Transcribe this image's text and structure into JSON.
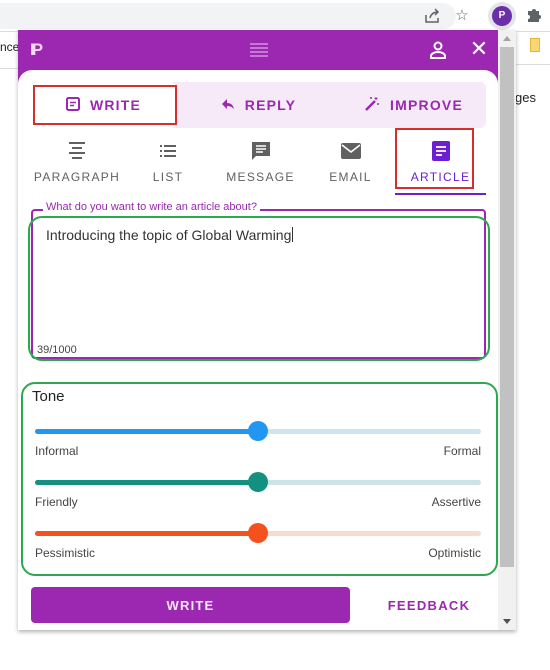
{
  "browser": {
    "icons": [
      "share-icon",
      "bookmark-star-icon",
      "extension-logo-icon",
      "extensions-puzzle-icon"
    ],
    "extension_logo_text": "P",
    "background_text_left": "nce",
    "background_text_right": "ges"
  },
  "popup": {
    "header": {
      "logo_text": "IP",
      "icons": [
        "drag-handle-icon",
        "user-icon",
        "close-icon"
      ],
      "close_glyph": "✕"
    },
    "mode_tabs": [
      {
        "label": "WRITE",
        "icon": "note-icon",
        "active": true,
        "highlighted": true
      },
      {
        "label": "REPLY",
        "icon": "reply-icon",
        "active": false
      },
      {
        "label": "IMPROVE",
        "icon": "magic-wand-icon",
        "active": false
      }
    ],
    "type_tabs": [
      {
        "label": "PARAGRAPH",
        "icon": "align-center-icon",
        "active": false
      },
      {
        "label": "LIST",
        "icon": "list-icon",
        "active": false
      },
      {
        "label": "MESSAGE",
        "icon": "chat-bubble-icon",
        "active": false
      },
      {
        "label": "EMAIL",
        "icon": "mail-icon",
        "active": false
      },
      {
        "label": "ARTICLE",
        "icon": "article-icon",
        "active": true,
        "highlighted": true
      }
    ],
    "prompt": {
      "label": "What do you want to write an article about?",
      "value": "Introducing the topic of Global Warming",
      "counter": "39/1000"
    },
    "tone": {
      "title": "Tone",
      "sliders": [
        {
          "left_label": "Informal",
          "right_label": "Formal",
          "value": 0.5,
          "color": "#2196f3",
          "track_color": "#cfe3f1"
        },
        {
          "left_label": "Friendly",
          "right_label": "Assertive",
          "value": 0.5,
          "color": "#139080",
          "track_color": "#cde4e6"
        },
        {
          "left_label": "Pessimistic",
          "right_label": "Optimistic",
          "value": 0.5,
          "color": "#f4511e",
          "track_color": "#f6dbd3"
        }
      ]
    },
    "footer": {
      "write_label": "WRITE",
      "feedback_label": "FEEDBACK"
    },
    "colors": {
      "brand": "#9c27b0",
      "active_tab": "#6a1fd3",
      "annotation_red": "#d32f2f",
      "annotation_green": "#2ea84e"
    }
  }
}
